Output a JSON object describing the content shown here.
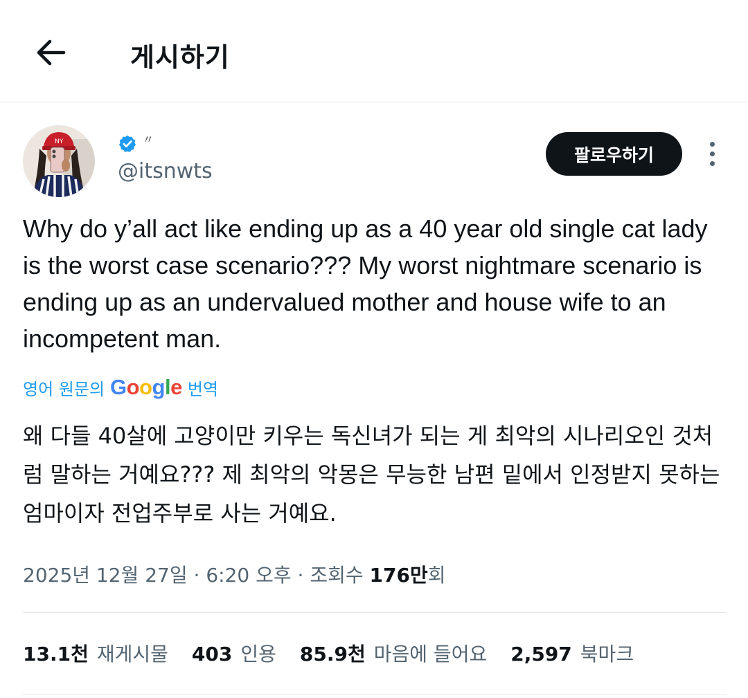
{
  "header": {
    "title": "게시하기",
    "back_icon": "arrow-left-icon"
  },
  "author": {
    "name_mark": "〃",
    "handle": "@itsnwts",
    "verified_color": "#1d9bf0",
    "follow_label": "팔로우하기"
  },
  "tweet": {
    "text": "Why do y’all act like ending up as a 40 year old single cat lady is the worst case scenario??? My worst nightmare scenario is ending up as an undervalued mother and house wife to an incompetent man.",
    "translate_prefix": "영어 원문의",
    "translate_brand": "Google",
    "translate_suffix": "번역",
    "translation": "왜 다들 40살에 고양이만 키우는 독신녀가 되는 게 최악의 시나리오인 것처럼 말하는 거예요??? 제 최악의 악몽은 무능한 남편 밑에서 인정받지 못하는 엄마이자 전업주부로 사는 거예요."
  },
  "meta": {
    "date": "2025년 12월 27일",
    "sep1": " · ",
    "time": "6:20 오후",
    "sep2": " · ",
    "views_label": "조회수",
    "views_value": "176만",
    "views_suffix": "회"
  },
  "stats": [
    {
      "value": "13.1천",
      "label": "재게시물"
    },
    {
      "value": "403",
      "label": "인용"
    },
    {
      "value": "85.9천",
      "label": "마음에 들어요"
    },
    {
      "value": "2,597",
      "label": "북마크"
    }
  ],
  "colors": {
    "text": "#0f1419",
    "secondary": "#536471",
    "link": "#1d9bf0",
    "divider": "#e3e6e9"
  }
}
